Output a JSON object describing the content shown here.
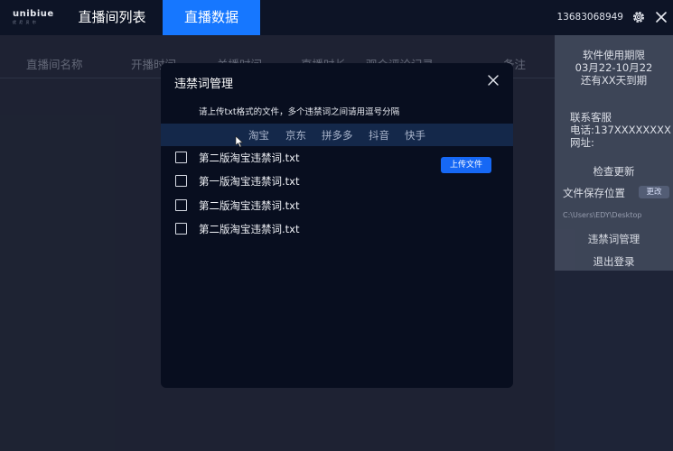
{
  "brand": {
    "logo_text": "unibiue",
    "logo_sub": "优 尼 贝 尔"
  },
  "nav": {
    "tabs": [
      {
        "label": "直播间列表"
      },
      {
        "label": "直播数据"
      }
    ]
  },
  "header": {
    "phone": "13683068949"
  },
  "table": {
    "columns": [
      "直播间名称",
      "开播时间",
      "关播时间",
      "直播时长",
      "观众评论记录",
      "备注"
    ]
  },
  "side_panel": {
    "license_title": "软件使用期限",
    "license_range": "03月22-10月22",
    "license_remaining": "还有XX天到期",
    "support_title": "联系客服",
    "support_phone": "电话:137XXXXXXXX",
    "support_site": "网址:",
    "check_update": "检查更新",
    "save_location_label": "文件保存位置",
    "change_button": "更改",
    "save_path": "C:\\Users\\EDY\\Desktop",
    "banned_words": "违禁词管理",
    "logout": "退出登录"
  },
  "modal": {
    "title": "违禁词管理",
    "description": "请上传txt格式的文件，多个违禁词之间请用逗号分隔",
    "platform_tabs": [
      "淘宝",
      "京东",
      "拼多多",
      "抖音",
      "快手"
    ],
    "upload_button": "上传文件",
    "files": [
      {
        "name": "第二版淘宝违禁词.txt"
      },
      {
        "name": "第一版淘宝违禁词.txt"
      },
      {
        "name": "第二版淘宝违禁词.txt"
      },
      {
        "name": "第二版淘宝违禁词.txt"
      }
    ]
  },
  "colors": {
    "accent": "#1677ff",
    "topbar": "#0d1426",
    "modal_bg": "#080e1f",
    "tabbar": "#14284a"
  }
}
